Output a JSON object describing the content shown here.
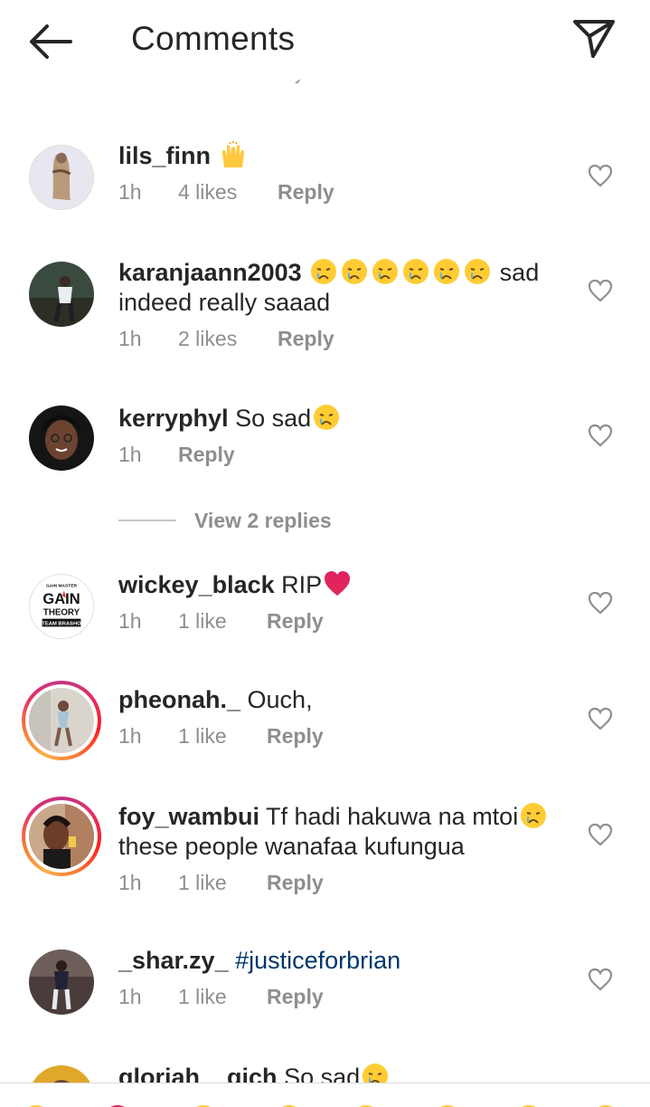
{
  "header": {
    "title": "Comments",
    "back_icon": "arrow-left-icon",
    "send_icon": "paper-plane-icon",
    "cut_text": "y"
  },
  "reply_label": "Reply",
  "comments": [
    {
      "username": "lils_finn",
      "text": "",
      "emojis": [
        "raising-hands"
      ],
      "time": "1h",
      "likes": "4 likes"
    },
    {
      "username": "karanjaann2003",
      "text_after_emojis": "sad",
      "text_line2": "indeed really saaad",
      "emojis": [
        "crying-face",
        "crying-face",
        "crying-face",
        "crying-face",
        "crying-face",
        "crying-face"
      ],
      "time": "1h",
      "likes": "2 likes"
    },
    {
      "username": "kerryphyl",
      "text": "So sad",
      "emojis": [
        "crying-face"
      ],
      "time": "1h",
      "likes": ""
    },
    {
      "username": "wickey_black",
      "text": "RIP",
      "emojis": [
        "red-heart"
      ],
      "time": "1h",
      "likes": "1 like"
    },
    {
      "username": "pheonah._",
      "text": "Ouch,",
      "time": "1h",
      "likes": "1 like"
    },
    {
      "username": "foy_wambui",
      "text": "Tf hadi hakuwa na mtoi",
      "emojis": [
        "crying-face"
      ],
      "text_line2": "these people wanafaa kufungua",
      "time": "1h",
      "likes": "1 like"
    },
    {
      "username": "_shar.zy_",
      "text": "#justiceforbrian",
      "time": "1h",
      "likes": "1 like"
    },
    {
      "username": "gloriah__gich",
      "text": "So sad",
      "emojis": [
        "crying-face"
      ]
    }
  ],
  "view_replies": "View 2 replies",
  "avatar_logo": {
    "line1": "GAIN MASTER",
    "line2": "GAIN",
    "line3": "THEORY",
    "line4": "TEAM BRASHO"
  },
  "colors": {
    "text": "#262626",
    "meta": "#8e8e8e",
    "hashtag": "#00376b",
    "heart_red": "#e0245e",
    "emoji_yellow": "#ffcc33"
  }
}
